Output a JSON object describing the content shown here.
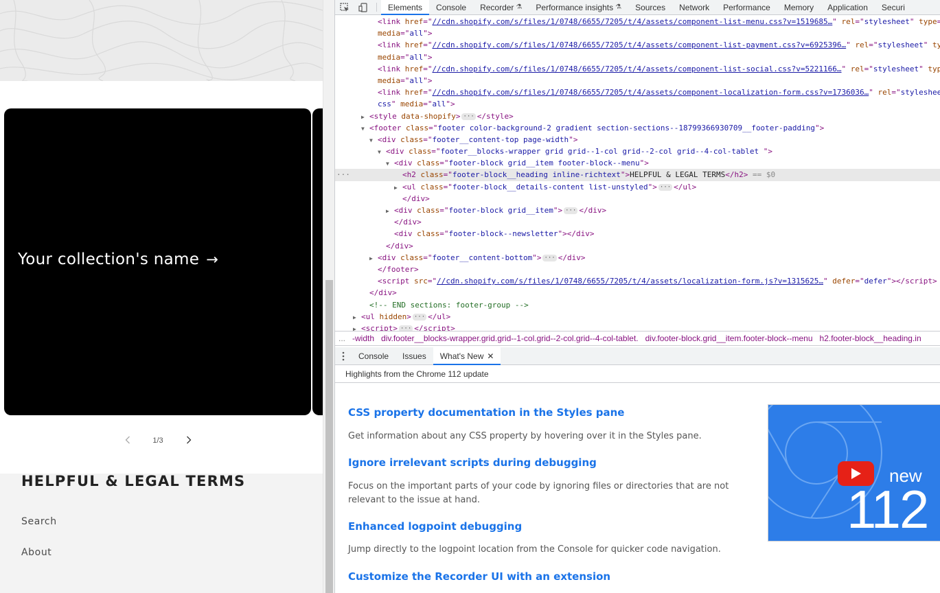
{
  "site": {
    "card_title": "Your collection's name",
    "card_arrow": "→",
    "slider_counter": "1/3",
    "footer_heading": "HELPFUL & LEGAL TERMS",
    "footer_links": [
      "Search",
      "About"
    ]
  },
  "devtools": {
    "tabs": [
      "Elements",
      "Console",
      "Recorder",
      "Performance insights",
      "Sources",
      "Network",
      "Performance",
      "Memory",
      "Application",
      "Securi"
    ],
    "active_tab": "Elements",
    "flask_glyph": "⚗",
    "breadcrumbs": [
      "...",
      "-width",
      "div.footer__blocks-wrapper.grid.grid--1-col.grid--2-col.grid--4-col-tablet.",
      "div.footer-block.grid__item.footer-block--menu",
      "h2.footer-block__heading.in"
    ],
    "drawer_tabs": [
      "Console",
      "Issues",
      "What's New"
    ],
    "active_drawer_tab": "What's New",
    "whats_new": {
      "header": "Highlights from the Chrome 112 update",
      "items": [
        {
          "title": "CSS property documentation in the Styles pane",
          "desc": "Get information about any CSS property by hovering over it in the Styles pane."
        },
        {
          "title": "Ignore irrelevant scripts during debugging",
          "desc": "Focus on the important parts of your code by ignoring files or directories that are not relevant to the issue at hand."
        },
        {
          "title": "Enhanced logpoint debugging",
          "desc": "Jump directly to the logpoint location from the Console for quicker code navigation."
        },
        {
          "title": "Customize the Recorder UI with an extension",
          "desc": ""
        }
      ],
      "video": {
        "label_new": "new",
        "label_version": "112"
      }
    },
    "colors": {
      "accent": "#1a73e8",
      "tag": "#881280",
      "attr_name": "#994500",
      "attr_value": "#1a1aa6",
      "comment": "#236e25"
    }
  },
  "dom_tree": {
    "lines": [
      {
        "indent": 4,
        "tri": "",
        "html": "<span class='tag'>&lt;link</span> <span class='an'>href</span>=\"<span class='url'>//cdn.shopify.com/s/files/1/0748/6655/7205/t/4/assets/component-list-menu.css?v=1519685…</span>\" <span class='an'>rel</span>=\"<span class='av'>stylesheet</span>\" <span class='an'>type</span>=\"<span class='av'>t</span>"
      },
      {
        "indent": 4,
        "tri": "",
        "html": "<span class='an'>media</span>=\"<span class='av'>all</span>\"<span class='tag'>&gt;</span>"
      },
      {
        "indent": 4,
        "tri": "",
        "html": "<span class='tag'>&lt;link</span> <span class='an'>href</span>=\"<span class='url'>//cdn.shopify.com/s/files/1/0748/6655/7205/t/4/assets/component-list-payment.css?v=6925396…</span>\" <span class='an'>rel</span>=\"<span class='av'>stylesheet</span>\" <span class='an'>type</span>"
      },
      {
        "indent": 4,
        "tri": "",
        "html": "<span class='an'>media</span>=\"<span class='av'>all</span>\"<span class='tag'>&gt;</span>"
      },
      {
        "indent": 4,
        "tri": "",
        "html": "<span class='tag'>&lt;link</span> <span class='an'>href</span>=\"<span class='url'>//cdn.shopify.com/s/files/1/0748/6655/7205/t/4/assets/component-list-social.css?v=5221166…</span>\" <span class='an'>rel</span>=\"<span class='av'>stylesheet</span>\" <span class='an'>type</span>="
      },
      {
        "indent": 4,
        "tri": "",
        "html": "<span class='an'>media</span>=\"<span class='av'>all</span>\"<span class='tag'>&gt;</span>"
      },
      {
        "indent": 4,
        "tri": "",
        "html": "<span class='tag'>&lt;link</span> <span class='an'>href</span>=\"<span class='url'>//cdn.shopify.com/s/files/1/0748/6655/7205/t/4/assets/component-localization-form.css?v=1736036…</span>\" <span class='an'>rel</span>=\"<span class='av'>stylesheet</span>\""
      },
      {
        "indent": 4,
        "tri": "",
        "html": "<span class='av'>css</span>\" <span class='an'>media</span>=\"<span class='av'>all</span>\"<span class='tag'>&gt;</span>"
      },
      {
        "indent": 3,
        "tri": "▶",
        "html": "<span class='tag'>&lt;style</span> <span class='an'>data-shopify</span><span class='tag'>&gt;</span><span class='ell'>···</span><span class='tag'>&lt;/style&gt;</span>"
      },
      {
        "indent": 3,
        "tri": "▼",
        "html": "<span class='tag'>&lt;footer</span> <span class='an'>class</span>=\"<span class='av'>footer color-background-2 gradient section-sections--18799366930709__footer-padding</span>\"<span class='tag'>&gt;</span>"
      },
      {
        "indent": 4,
        "tri": "▼",
        "html": "<span class='tag'>&lt;div</span> <span class='an'>class</span>=\"<span class='av'>footer__content-top page-width</span>\"<span class='tag'>&gt;</span>"
      },
      {
        "indent": 5,
        "tri": "▼",
        "html": "<span class='tag'>&lt;div</span> <span class='an'>class</span>=\"<span class='av'>footer__blocks-wrapper grid grid--1-col grid--2-col grid--4-col-tablet </span>\"<span class='tag'>&gt;</span>"
      },
      {
        "indent": 6,
        "tri": "▼",
        "html": "<span class='tag'>&lt;div</span> <span class='an'>class</span>=\"<span class='av'>footer-block grid__item footer-block--menu</span>\"<span class='tag'>&gt;</span>"
      },
      {
        "indent": 7,
        "tri": "",
        "sel": true,
        "html": "<span class='tag'>&lt;h2</span> <span class='an'>class</span>=\"<span class='av'>footer-block__heading inline-richtext</span>\"<span class='tag'>&gt;</span><span class='txt'>HELPFUL &amp; LEGAL TERMS</span><span class='tag'>&lt;/h2&gt;</span> <span class='eq'>== $0</span>"
      },
      {
        "indent": 7,
        "tri": "▶",
        "html": "<span class='tag'>&lt;ul</span> <span class='an'>class</span>=\"<span class='av'>footer-block__details-content list-unstyled</span>\"<span class='tag'>&gt;</span><span class='ell'>···</span><span class='tag'>&lt;/ul&gt;</span>"
      },
      {
        "indent": 7,
        "tri": "",
        "html": "<span class='tag'>&lt;/div&gt;</span>"
      },
      {
        "indent": 6,
        "tri": "▶",
        "html": "<span class='tag'>&lt;div</span> <span class='an'>class</span>=\"<span class='av'>footer-block grid__item</span>\"<span class='tag'>&gt;</span><span class='ell'>···</span><span class='tag'>&lt;/div&gt;</span>"
      },
      {
        "indent": 6,
        "tri": "",
        "html": "<span class='tag'>&lt;/div&gt;</span>"
      },
      {
        "indent": 6,
        "tri": "",
        "html": "<span class='tag'>&lt;div</span> <span class='an'>class</span>=\"<span class='av'>footer-block--newsletter</span>\"<span class='tag'>&gt;&lt;/div&gt;</span>"
      },
      {
        "indent": 5,
        "tri": "",
        "html": "<span class='tag'>&lt;/div&gt;</span>"
      },
      {
        "indent": 4,
        "tri": "▶",
        "html": "<span class='tag'>&lt;div</span> <span class='an'>class</span>=\"<span class='av'>footer__content-bottom</span>\"<span class='tag'>&gt;</span><span class='ell'>···</span><span class='tag'>&lt;/div&gt;</span>"
      },
      {
        "indent": 4,
        "tri": "",
        "html": "<span class='tag'>&lt;/footer&gt;</span>"
      },
      {
        "indent": 4,
        "tri": "",
        "html": "<span class='tag'>&lt;script</span> <span class='an'>src</span>=\"<span class='url'>//cdn.shopify.com/s/files/1/0748/6655/7205/t/4/assets/localization-form.js?v=1315625…</span>\" <span class='an'>defer</span>=\"<span class='av'>defer</span>\"<span class='tag'>&gt;&lt;/script&gt;</span>"
      },
      {
        "indent": 3,
        "tri": "",
        "html": "<span class='tag'>&lt;/div&gt;</span>"
      },
      {
        "indent": 3,
        "tri": "",
        "html": "<span class='cmt'>&lt;!-- END sections: footer-group --&gt;</span>"
      },
      {
        "indent": 2,
        "tri": "▶",
        "html": "<span class='tag'>&lt;ul</span> <span class='an'>hidden</span><span class='tag'>&gt;</span><span class='ell'>···</span><span class='tag'>&lt;/ul&gt;</span>"
      },
      {
        "indent": 2,
        "tri": "▶",
        "html": "<span class='tag'>&lt;script&gt;</span><span class='ell'>···</span><span class='tag'>&lt;/script&gt;</span>"
      }
    ]
  }
}
